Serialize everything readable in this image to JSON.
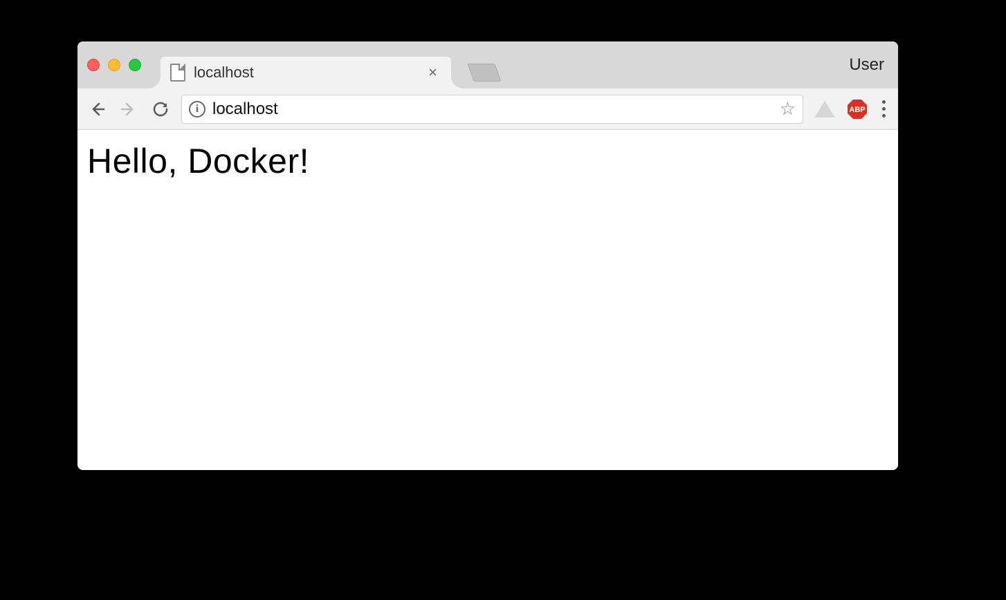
{
  "window": {
    "user_label": "User"
  },
  "tabs": [
    {
      "title": "localhost"
    }
  ],
  "addressbar": {
    "url": "localhost"
  },
  "page": {
    "heading": "Hello, Docker!"
  }
}
